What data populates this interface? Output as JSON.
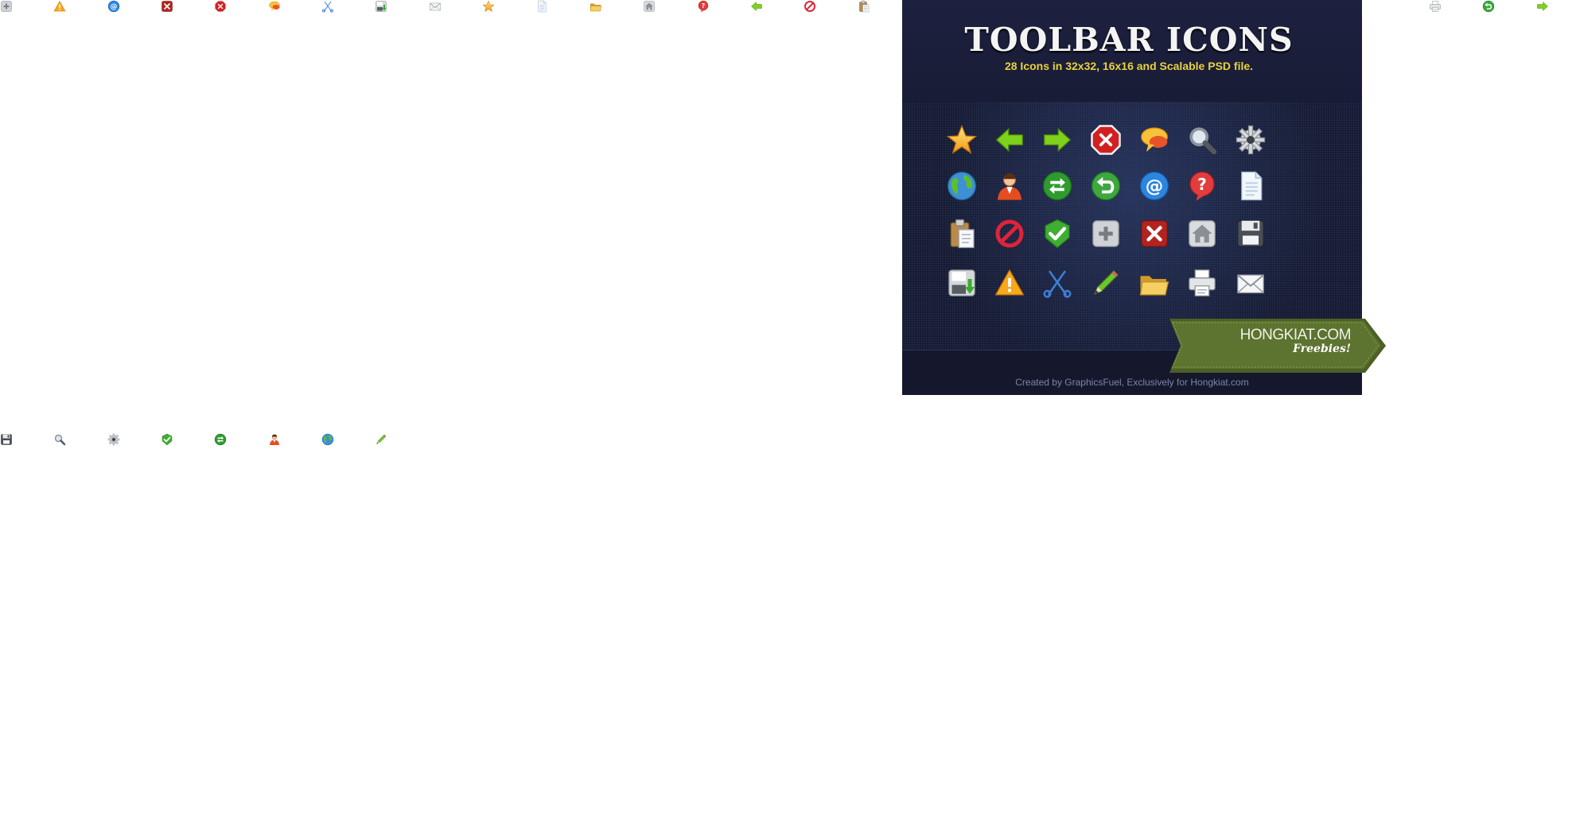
{
  "top_strip": [
    {
      "icon": "add-icon"
    },
    {
      "icon": "warning-icon"
    },
    {
      "icon": "email-at-icon"
    },
    {
      "icon": "delete-square-icon"
    },
    {
      "icon": "stop-icon"
    },
    {
      "icon": "chat-bubble-icon"
    },
    {
      "icon": "scissors-icon"
    },
    {
      "icon": "save-download-icon"
    },
    {
      "icon": "mail-icon"
    },
    {
      "icon": "star-icon"
    },
    {
      "icon": "document-icon"
    },
    {
      "icon": "folder-icon"
    },
    {
      "icon": "home-icon"
    },
    {
      "icon": "help-icon"
    },
    {
      "icon": "arrow-left-icon"
    },
    {
      "icon": "block-icon"
    },
    {
      "icon": "clipboard-icon"
    },
    {
      "icon": "printer-icon"
    },
    {
      "icon": "undo-icon"
    },
    {
      "icon": "arrow-right-icon"
    }
  ],
  "bottom_strip": [
    {
      "icon": "floppy-disk-icon"
    },
    {
      "icon": "search-icon"
    },
    {
      "icon": "gear-icon"
    },
    {
      "icon": "check-icon"
    },
    {
      "icon": "refresh-icon"
    },
    {
      "icon": "user-icon"
    },
    {
      "icon": "globe-icon"
    },
    {
      "icon": "pencil-icon"
    }
  ],
  "panel": {
    "title": "TOOLBAR ICONS",
    "subtitle": "28 Icons in 32x32, 16x16 and Scalable PSD file.",
    "credit": "Created by GraphicsFuel, Exclusively for Hongkiat.com",
    "ribbon_brand": "HONGKIAT.COM",
    "ribbon_tag": "Freebies!",
    "grid": [
      [
        "star-icon",
        "arrow-left-icon",
        "arrow-right-icon",
        "stop-icon",
        "chat-bubble-icon",
        "search-icon",
        "gear-icon"
      ],
      [
        "globe-icon",
        "user-icon",
        "refresh-icon",
        "undo-icon",
        "email-at-icon",
        "help-icon",
        "document-icon"
      ],
      [
        "clipboard-icon",
        "block-icon",
        "check-icon",
        "add-icon",
        "delete-square-icon",
        "home-icon",
        "floppy-disk-icon"
      ],
      [
        "save-download-icon",
        "warning-icon",
        "scissors-icon",
        "pencil-icon",
        "folder-icon",
        "printer-icon",
        "mail-icon"
      ]
    ]
  },
  "colors": {
    "panel_bg": "#171b31",
    "title": "#f4f4f4",
    "subtitle": "#e8d23c",
    "credit": "#7b84a8",
    "ribbon": "#55692a"
  }
}
